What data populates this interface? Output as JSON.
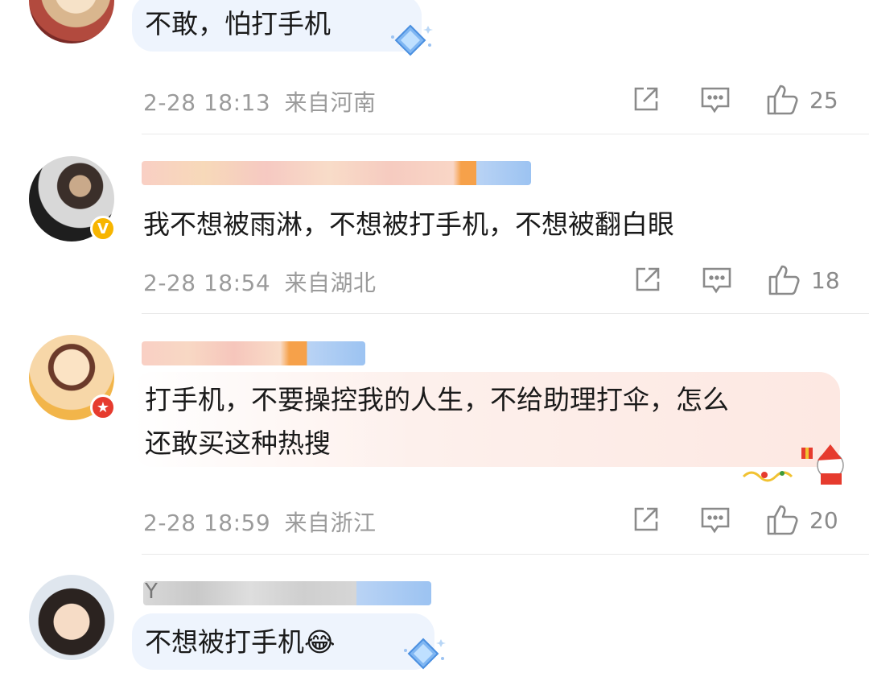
{
  "comments": [
    {
      "text": "不敢，怕打手机",
      "time": "2-28 18:13",
      "location": "来自河南",
      "likes": "25",
      "bubble_color": "#eef4fd"
    },
    {
      "text": "我不想被雨淋，不想被打手机，不想被翻白眼",
      "time": "2-28 18:54",
      "location": "来自湖北",
      "likes": "18",
      "badge": "V",
      "badge_color": "#f7b500"
    },
    {
      "text_line1": "打手机，不要操控我的人生，不给助理打伞，怎么",
      "text_line2": "还敢买这种热搜",
      "time": "2-28 18:59",
      "location": "来自浙江",
      "likes": "20",
      "badge": "★",
      "badge_color": "#e63b2e",
      "bubble_color": "#fdeeea"
    },
    {
      "text": "不想被打手机😂",
      "name_visible": "Y",
      "bubble_color": "#eef4fd"
    }
  ],
  "icons": [
    "share-icon",
    "comment-icon",
    "like-icon"
  ],
  "colors": {
    "meta": "#9b9b9b",
    "divider": "#e9e9e9",
    "vip_blue": "#9cc3f2",
    "vip_orange": "#f6a14a"
  }
}
